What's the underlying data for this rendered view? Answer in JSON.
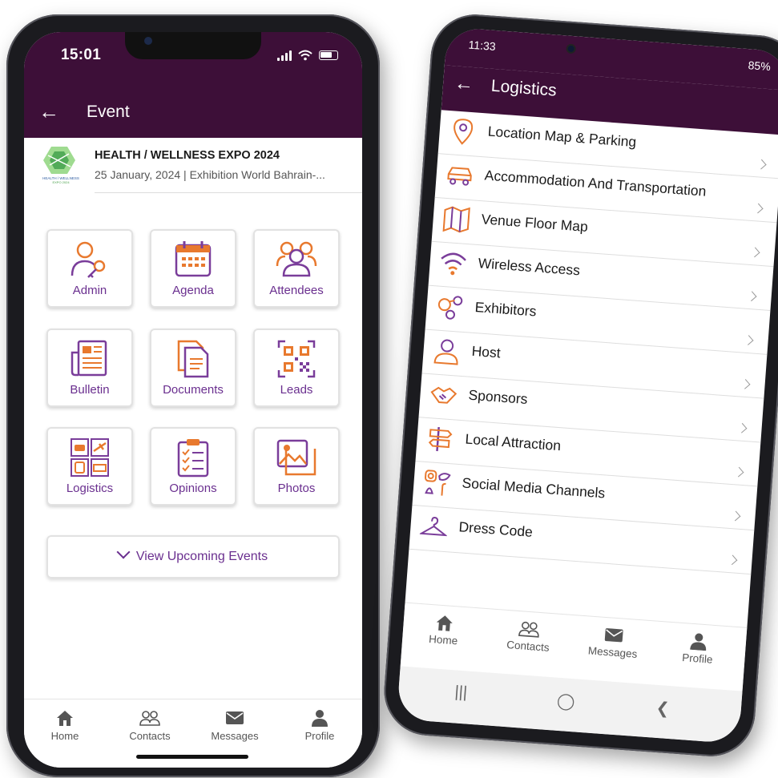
{
  "colors": {
    "brand": "#3d0f38",
    "accent": "#6a2f8f",
    "icon_orange": "#e8792e"
  },
  "left_phone": {
    "status_time": "15:01",
    "title": "Event",
    "event": {
      "name": "HEALTH / WELLNESS EXPO 2024",
      "details": "25 January, 2024 | Exhibition World Bahrain-..."
    },
    "tiles": [
      {
        "label": "Admin",
        "icon": "admin-key-icon"
      },
      {
        "label": "Agenda",
        "icon": "calendar-icon"
      },
      {
        "label": "Attendees",
        "icon": "attendees-icon"
      },
      {
        "label": "Bulletin",
        "icon": "newspaper-icon"
      },
      {
        "label": "Documents",
        "icon": "documents-icon"
      },
      {
        "label": "Leads",
        "icon": "qr-code-icon"
      },
      {
        "label": "Logistics",
        "icon": "logistics-icon"
      },
      {
        "label": "Opinions",
        "icon": "clipboard-checklist-icon"
      },
      {
        "label": "Photos",
        "icon": "photos-icon"
      }
    ],
    "upcoming_label": "View Upcoming Events",
    "tabs": [
      {
        "label": "Home",
        "icon": "home-icon"
      },
      {
        "label": "Contacts",
        "icon": "contacts-icon"
      },
      {
        "label": "Messages",
        "icon": "envelope-icon"
      },
      {
        "label": "Profile",
        "icon": "profile-icon"
      }
    ]
  },
  "right_phone": {
    "status_time": "11:33",
    "battery": "85%",
    "title": "Logistics",
    "items": [
      {
        "label": "Location Map & Parking",
        "icon": "location-pin-icon"
      },
      {
        "label": "Accommodation And Transportation",
        "icon": "car-icon"
      },
      {
        "label": "Venue Floor Map",
        "icon": "folded-map-icon"
      },
      {
        "label": "Wireless Access",
        "icon": "wifi-icon"
      },
      {
        "label": "Exhibitors",
        "icon": "exhibitors-icon"
      },
      {
        "label": "Host",
        "icon": "host-person-icon"
      },
      {
        "label": "Sponsors",
        "icon": "handshake-icon"
      },
      {
        "label": "Local Attraction",
        "icon": "signpost-icon"
      },
      {
        "label": "Social Media Channels",
        "icon": "social-media-icon"
      },
      {
        "label": "Dress Code",
        "icon": "hanger-icon"
      }
    ],
    "tabs": [
      {
        "label": "Home",
        "icon": "home-icon"
      },
      {
        "label": "Contacts",
        "icon": "contacts-icon"
      },
      {
        "label": "Messages",
        "icon": "envelope-icon"
      },
      {
        "label": "Profile",
        "icon": "profile-icon"
      }
    ]
  }
}
